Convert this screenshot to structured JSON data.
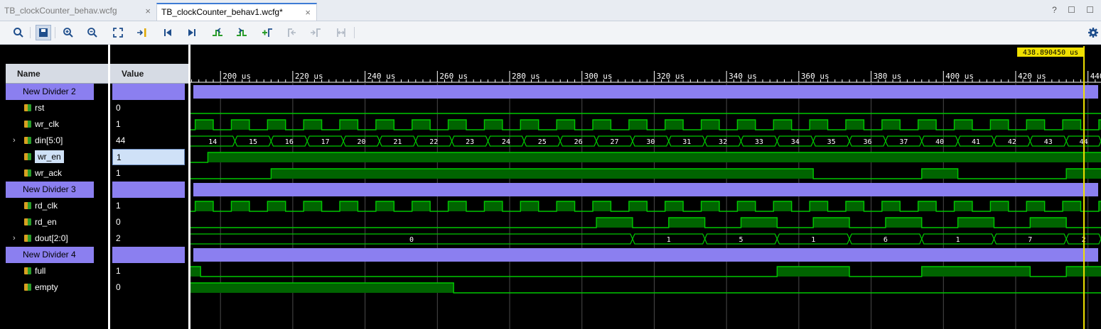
{
  "tabs": [
    {
      "label": "TB_clockCounter_behav.wcfg",
      "active": false
    },
    {
      "label": "TB_clockCounter_behav1.wcfg*",
      "active": true
    }
  ],
  "tab_close_glyph": "×",
  "window_controls": "? ☐ ☐",
  "toolbar_icons": [
    "search-icon",
    "save-icon",
    "zoom-in-icon",
    "zoom-out-icon",
    "zoom-fit-icon",
    "go-to-cursor-icon",
    "go-to-start-icon",
    "go-to-end-icon",
    "previous-transition-icon",
    "next-transition-icon",
    "add-marker-icon",
    "previous-marker-icon",
    "next-marker-icon",
    "swap-cursors-icon",
    "settings-gear-icon"
  ],
  "columns": {
    "name": "Name",
    "value": "Value"
  },
  "cursor": {
    "label": "438.890450 us",
    "time_us": 438.89
  },
  "time_axis": {
    "start_us": 191.7,
    "end_us": 443.6,
    "ticks": [
      "200 us",
      "220 us",
      "240 us",
      "260 us",
      "280 us",
      "300 us",
      "320 us",
      "340 us",
      "360 us",
      "380 us",
      "400 us",
      "420 us",
      "440 us"
    ]
  },
  "colors": {
    "divider": "#8b7ff0",
    "trace": "#00c800",
    "fill": "#006400",
    "cursor": "#f0e000",
    "bus_outline": "#00c800",
    "bus_text": "#ffffff"
  },
  "rows": [
    {
      "name": "New Divider 2",
      "value": "",
      "kind": "divider"
    },
    {
      "name": "rst",
      "value": "0",
      "kind": "bit",
      "icon": "signal-icon"
    },
    {
      "name": "wr_clk",
      "value": "1",
      "kind": "bit",
      "icon": "signal-icon"
    },
    {
      "name": "din[5:0]",
      "value": "44",
      "kind": "bus",
      "icon": "bus-icon",
      "expand": "›"
    },
    {
      "name": "wr_en",
      "value": "1",
      "kind": "bit",
      "icon": "signal-icon",
      "selected": true
    },
    {
      "name": "wr_ack",
      "value": "1",
      "kind": "bit",
      "icon": "signal-icon"
    },
    {
      "name": "New Divider 3",
      "value": "",
      "kind": "divider"
    },
    {
      "name": "rd_clk",
      "value": "1",
      "kind": "bit",
      "icon": "signal-icon"
    },
    {
      "name": "rd_en",
      "value": "0",
      "kind": "bit",
      "icon": "signal-icon"
    },
    {
      "name": "dout[2:0]",
      "value": "2",
      "kind": "bus",
      "icon": "bus-icon",
      "expand": "›"
    },
    {
      "name": "New Divider 4",
      "value": "",
      "kind": "divider"
    },
    {
      "name": "full",
      "value": "1",
      "kind": "bit",
      "icon": "signal-icon"
    },
    {
      "name": "empty",
      "value": "0",
      "kind": "bit",
      "icon": "signal-icon"
    }
  ],
  "waves": {
    "clk_period_us": 10,
    "clk_first_rise_us": 193,
    "wr_en": [
      [
        191.7,
        0
      ],
      [
        196.5,
        1
      ]
    ],
    "wr_ack": [
      [
        191.7,
        0
      ],
      [
        214,
        1
      ],
      [
        364,
        0
      ],
      [
        394,
        1
      ],
      [
        404,
        0
      ],
      [
        434,
        1
      ]
    ],
    "rd_en": [
      [
        191.7,
        0
      ],
      [
        304,
        1
      ],
      [
        314,
        0
      ],
      [
        324,
        1
      ],
      [
        334,
        0
      ],
      [
        344,
        1
      ],
      [
        354,
        0
      ],
      [
        364,
        1
      ],
      [
        374,
        0
      ],
      [
        384,
        1
      ],
      [
        394,
        0
      ],
      [
        404,
        1
      ],
      [
        414,
        0
      ],
      [
        424,
        1
      ],
      [
        434,
        0
      ]
    ],
    "full": [
      [
        191.7,
        1
      ],
      [
        194.5,
        0
      ],
      [
        354,
        1
      ],
      [
        374,
        0
      ],
      [
        394,
        1
      ],
      [
        424,
        0
      ],
      [
        434,
        1
      ]
    ],
    "empty": [
      [
        191.7,
        1
      ],
      [
        264.5,
        0
      ]
    ],
    "din": [
      {
        "t": 191.7,
        "v": "14"
      },
      {
        "t": 204,
        "v": "15"
      },
      {
        "t": 214,
        "v": "16"
      },
      {
        "t": 224,
        "v": "17"
      },
      {
        "t": 234,
        "v": "20"
      },
      {
        "t": 244,
        "v": "21"
      },
      {
        "t": 254,
        "v": "22"
      },
      {
        "t": 264,
        "v": "23"
      },
      {
        "t": 274,
        "v": "24"
      },
      {
        "t": 284,
        "v": "25"
      },
      {
        "t": 294,
        "v": "26"
      },
      {
        "t": 304,
        "v": "27"
      },
      {
        "t": 314,
        "v": "30"
      },
      {
        "t": 324,
        "v": "31"
      },
      {
        "t": 334,
        "v": "32"
      },
      {
        "t": 344,
        "v": "33"
      },
      {
        "t": 354,
        "v": "34"
      },
      {
        "t": 364,
        "v": "35"
      },
      {
        "t": 374,
        "v": "36"
      },
      {
        "t": 384,
        "v": "37"
      },
      {
        "t": 394,
        "v": "40"
      },
      {
        "t": 404,
        "v": "41"
      },
      {
        "t": 414,
        "v": "42"
      },
      {
        "t": 424,
        "v": "43"
      },
      {
        "t": 434,
        "v": "44"
      }
    ],
    "dout": [
      {
        "t": 191.7,
        "v": "0"
      },
      {
        "t": 314,
        "v": "1"
      },
      {
        "t": 334,
        "v": "5"
      },
      {
        "t": 354,
        "v": "1"
      },
      {
        "t": 374,
        "v": "6"
      },
      {
        "t": 394,
        "v": "1"
      },
      {
        "t": 414,
        "v": "7"
      },
      {
        "t": 434,
        "v": "2"
      }
    ]
  }
}
